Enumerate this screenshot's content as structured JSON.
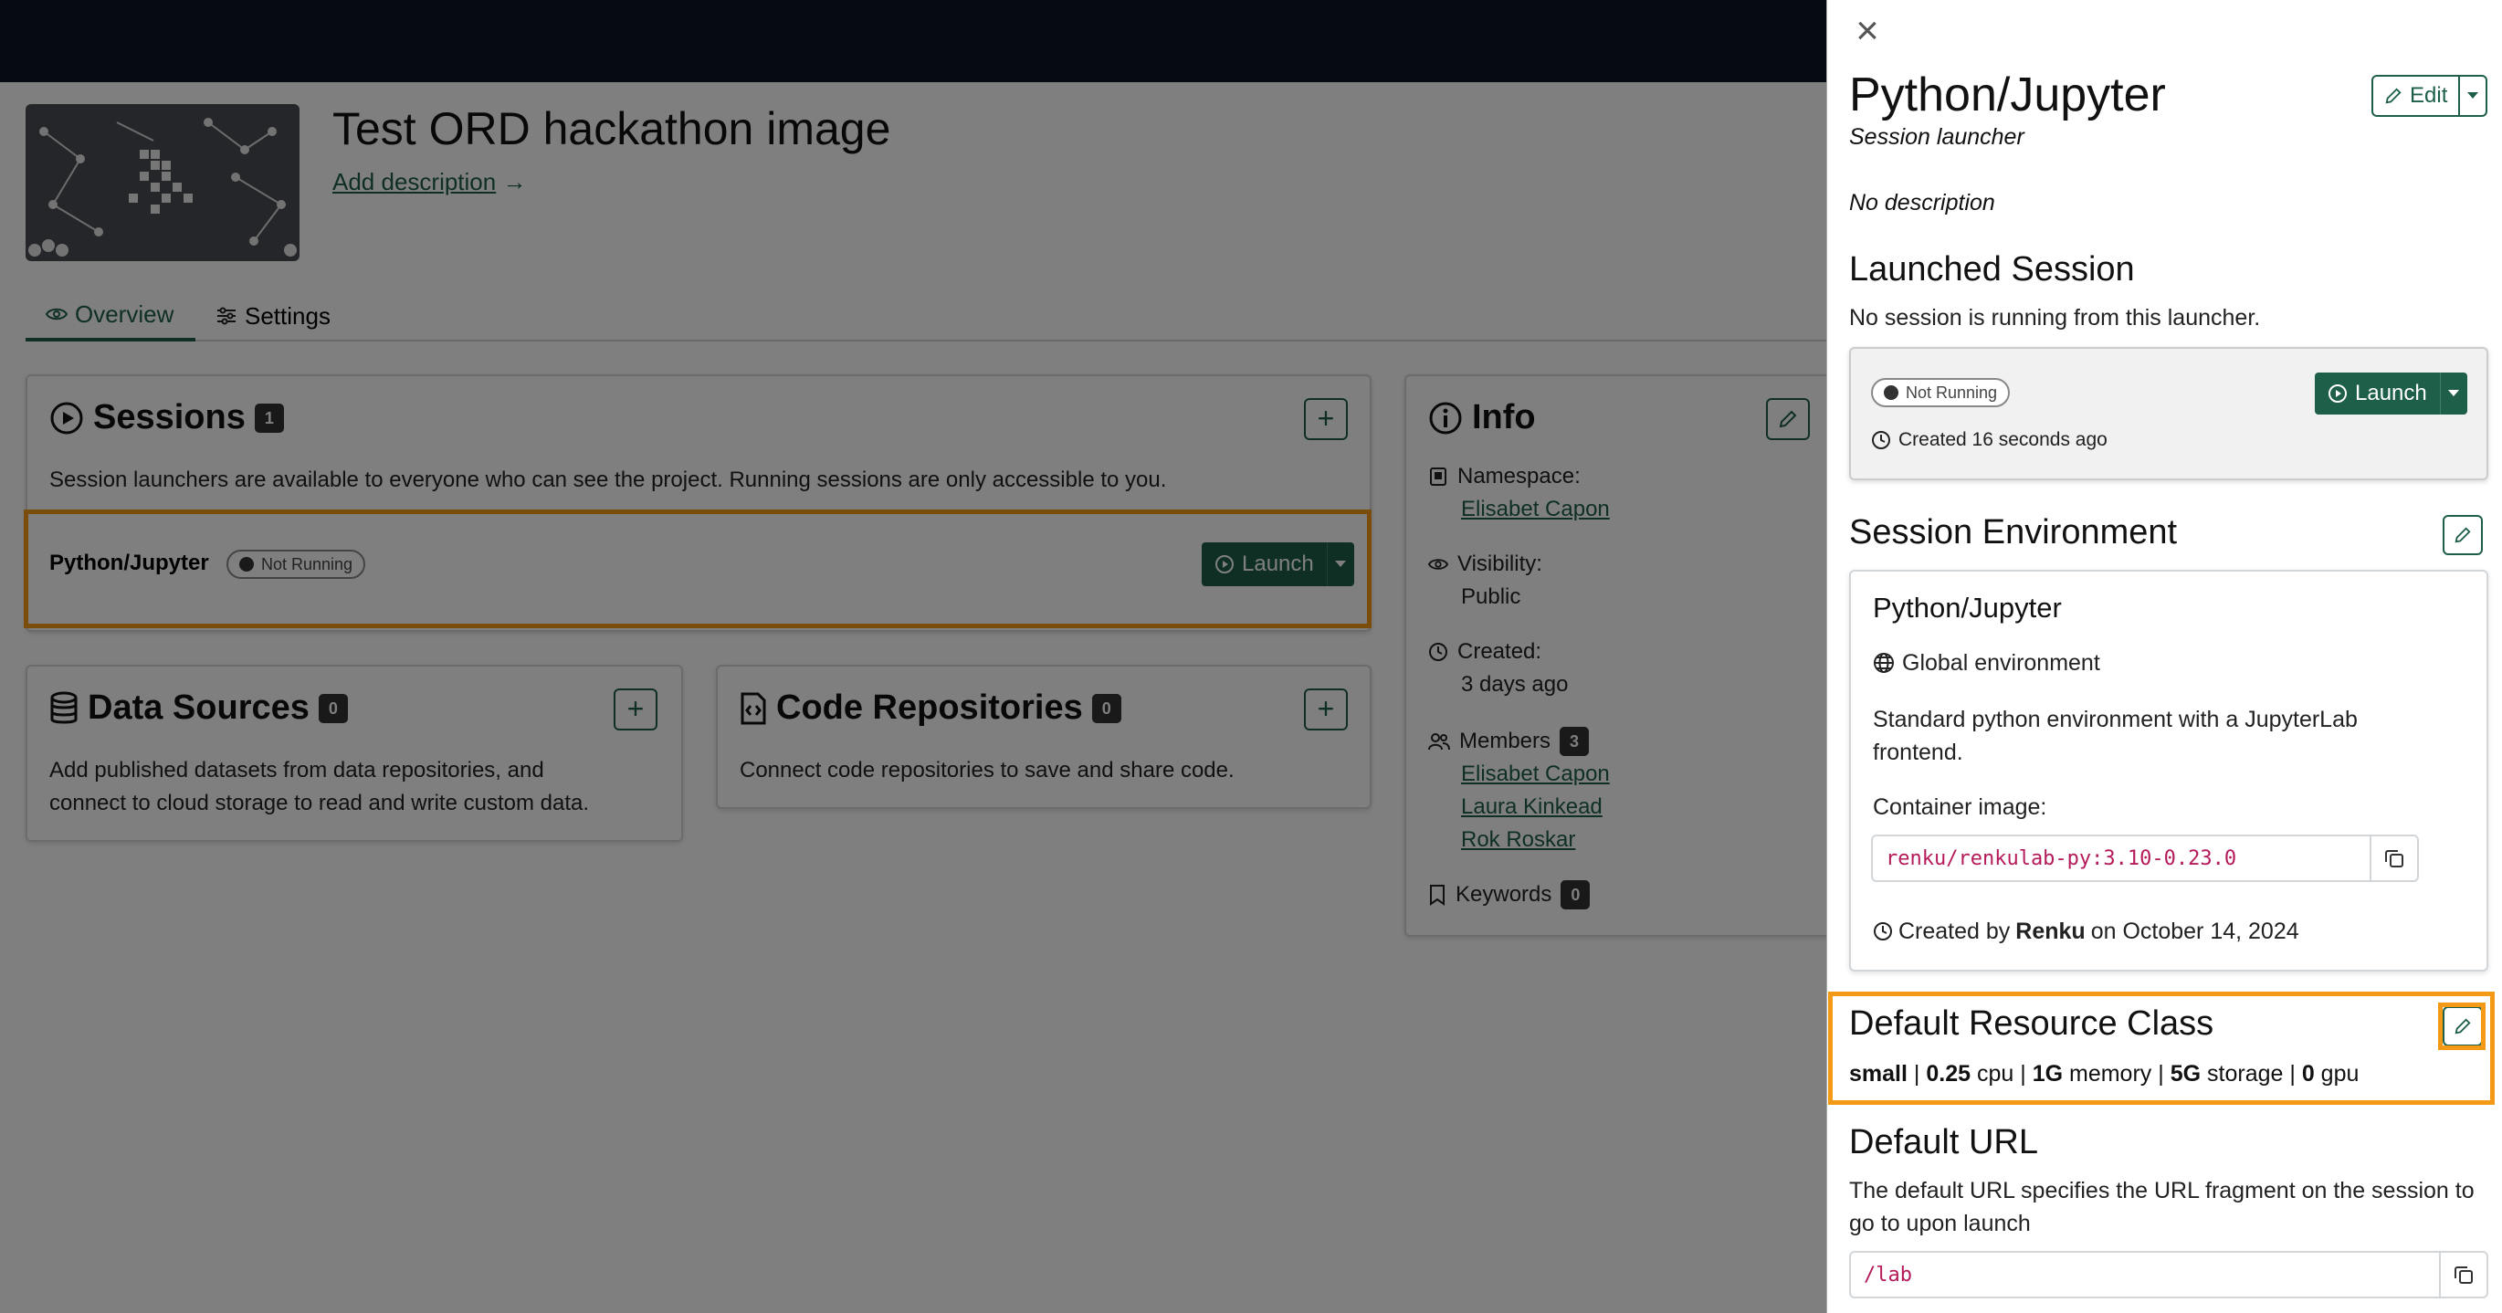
{
  "project": {
    "title": "Test ORD hackathon image",
    "add_description": "Add description",
    "add_description_arrow": "→",
    "tabs": [
      {
        "label": "Overview"
      },
      {
        "label": "Settings"
      }
    ]
  },
  "sessions_card": {
    "title": "Sessions",
    "count": "1",
    "text": "Session launchers are available to everyone who can see the project. Running sessions are only accessible to you.",
    "launcher": {
      "name": "Python/Jupyter",
      "status": "Not Running",
      "launch_label": "Launch"
    }
  },
  "data_sources_card": {
    "title": "Data Sources",
    "count": "0",
    "text_line1": "Add published datasets from data repositories, and",
    "text_line2": "connect to cloud storage to read and write custom data."
  },
  "code_repos_card": {
    "title": "Code Repositories",
    "count": "0",
    "text": "Connect code repositories to save and share code."
  },
  "info_card": {
    "title": "Info",
    "namespace_label": "Namespace:",
    "namespace_value": "Elisabet Capon",
    "visibility_label": "Visibility:",
    "visibility_value": "Public",
    "created_label": "Created:",
    "created_value": "3 days ago",
    "members_label": "Members",
    "members_count": "3",
    "members": [
      "Elisabet Capon",
      "Laura Kinkead",
      "Rok Roskar"
    ],
    "keywords_label": "Keywords",
    "keywords_count": "0"
  },
  "panel": {
    "title": "Python/Jupyter",
    "subtitle": "Session launcher",
    "edit_label": "Edit",
    "description": "No description",
    "launched_heading": "Launched Session",
    "launched_text": "No session is running from this launcher.",
    "session_status": "Not Running",
    "launch_label": "Launch",
    "created_text": "Created 16 seconds ago",
    "env_heading": "Session Environment",
    "env": {
      "name": "Python/Jupyter",
      "scope": "Global environment",
      "desc_line1": "Standard python environment with a JupyterLab",
      "desc_line2": "frontend.",
      "container_label": "Container image:",
      "container_image": "renku/renkulab-py:3.10-0.23.0",
      "created_prefix": "Created by",
      "created_by": "Renku",
      "created_suffix": "on October 14, 2024"
    },
    "resource_heading": "Default Resource Class",
    "resource": {
      "name": "small",
      "cpu_value": "0.25",
      "cpu_unit": "cpu",
      "memory_value": "1G",
      "memory_unit": "memory",
      "storage_value": "5G",
      "storage_unit": "storage",
      "gpu_value": "0",
      "gpu_unit": "gpu",
      "separator": "|"
    },
    "url_heading": "Default URL",
    "url_text_line1": "The default URL specifies the URL fragment on the session to",
    "url_text_line2": "go to upon launch",
    "url_value": "/lab"
  },
  "colors": {
    "accent": "#1e5f4a",
    "highlight": "#f49a16",
    "topbar": "#0a1622",
    "code": "#b51a5a"
  },
  "icons": [
    "close-icon",
    "play-circle-icon",
    "info-icon",
    "database-icon",
    "code-icon",
    "pencil-icon",
    "plus-icon",
    "eye-icon",
    "sliders-icon",
    "clock-icon",
    "people-icon",
    "bookmark-icon",
    "globe-icon",
    "copy-icon",
    "caret-down-icon",
    "namespace-icon"
  ]
}
